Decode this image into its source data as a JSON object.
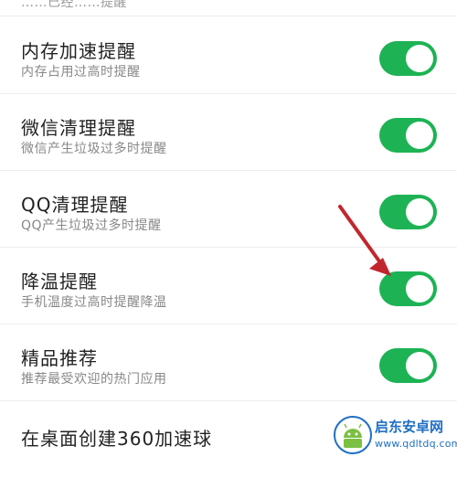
{
  "top_partial_text": "……已经……提醒",
  "colors": {
    "toggle_on": "#1db354",
    "arrow": "#c0272d"
  },
  "settings": [
    {
      "title": "内存加速提醒",
      "subtitle": "内存占用过高时提醒",
      "enabled": true
    },
    {
      "title": "微信清理提醒",
      "subtitle": "微信产生垃圾过多时提醒",
      "enabled": true
    },
    {
      "title": "QQ清理提醒",
      "subtitle": "QQ产生垃圾过多时提醒",
      "enabled": true
    },
    {
      "title": "降温提醒",
      "subtitle": "手机温度过高时提醒降温",
      "enabled": true
    },
    {
      "title": "精品推荐",
      "subtitle": "推荐最受欢迎的热门应用",
      "enabled": true
    }
  ],
  "bottom_item": {
    "title": "在桌面创建360加速球"
  },
  "watermark": {
    "name": "启东安卓网",
    "url": "www.qdltdq.com",
    "icon": "android-logo-icon"
  }
}
